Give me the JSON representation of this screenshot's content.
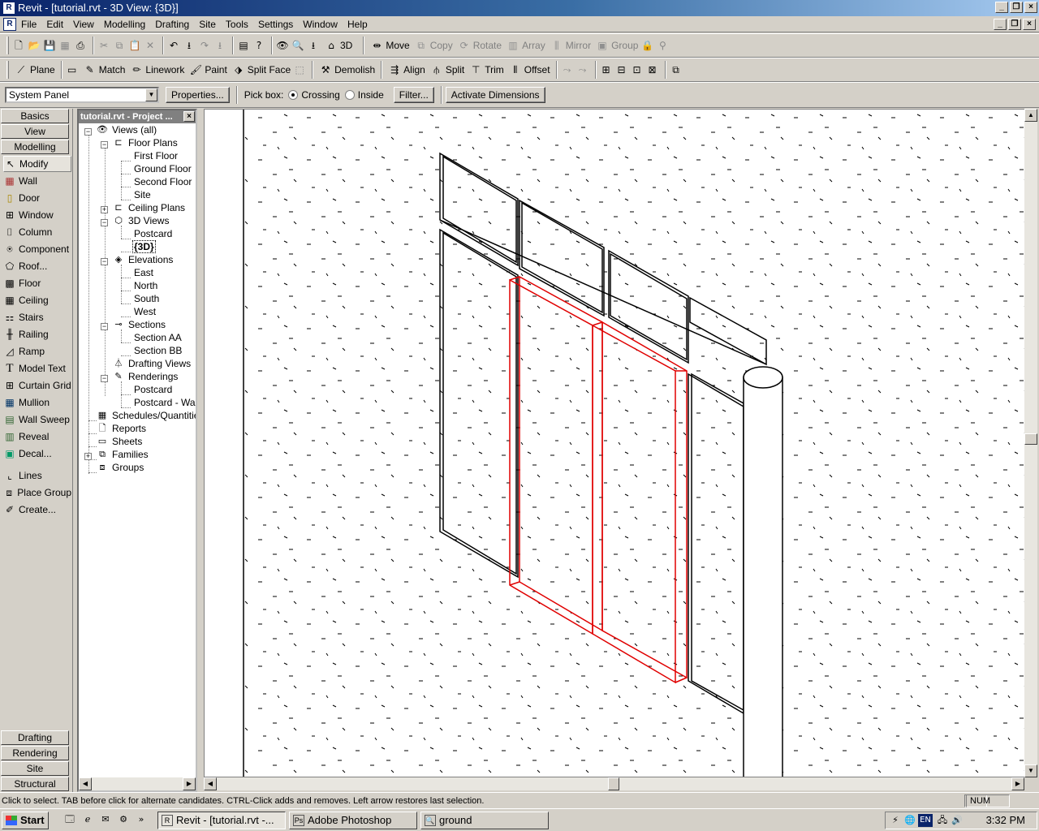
{
  "window": {
    "title": "Revit - [tutorial.rvt - 3D View: {3D}]"
  },
  "menu": [
    "File",
    "Edit",
    "View",
    "Modelling",
    "Drafting",
    "Site",
    "Tools",
    "Settings",
    "Window",
    "Help"
  ],
  "toolbar1": {
    "three_d": "3D",
    "move": "Move",
    "copy": "Copy",
    "rotate": "Rotate",
    "array": "Array",
    "mirror": "Mirror",
    "group": "Group"
  },
  "toolbar2": {
    "plane": "Plane",
    "match": "Match",
    "linework": "Linework",
    "paint": "Paint",
    "split_face": "Split Face",
    "demolish": "Demolish",
    "align": "Align",
    "split": "Split",
    "trim": "Trim",
    "offset": "Offset"
  },
  "options_bar": {
    "type_selector": "System Panel",
    "properties": "Properties...",
    "pick_box_label": "Pick box:",
    "crossing": "Crossing",
    "inside": "Inside",
    "filter": "Filter...",
    "activate_dimensions": "Activate Dimensions"
  },
  "design_bar": {
    "tabs_top": [
      "Basics",
      "View",
      "Modelling"
    ],
    "tools": [
      "Modify",
      "Wall",
      "Door",
      "Window",
      "Column",
      "Component",
      "Roof...",
      "Floor",
      "Ceiling",
      "Stairs",
      "Railing",
      "Ramp",
      "Model Text",
      "Curtain Grid",
      "Mullion",
      "Wall Sweep",
      "Reveal",
      "Decal...",
      "Lines",
      "Place Group",
      "Create..."
    ],
    "tabs_bottom": [
      "Drafting",
      "Rendering",
      "Site",
      "Structural"
    ]
  },
  "project_browser": {
    "title": "tutorial.rvt - Project ...",
    "nodes": [
      "Views (all)",
      "Floor Plans",
      "First Floor",
      "Ground Floor",
      "Second Floor",
      "Site",
      "Ceiling Plans",
      "3D Views",
      "Postcard",
      "{3D}",
      "Elevations",
      "East",
      "North",
      "South",
      "West",
      "Sections",
      "Section AA",
      "Section BB",
      "Drafting Views",
      "Renderings",
      "Postcard",
      "Postcard - Wall",
      "Schedules/Quantities",
      "Reports",
      "Sheets",
      "Families",
      "Groups"
    ]
  },
  "status_bar": {
    "message": "Click to select. TAB before click for alternate candidates. CTRL-Click adds and removes. Left arrow restores last selection.",
    "num": "NUM"
  },
  "taskbar": {
    "start": "Start",
    "tasks": [
      "Revit - [tutorial.rvt -...",
      "Adobe Photoshop",
      "ground"
    ],
    "lang": "EN",
    "clock": "3:32 PM"
  },
  "colors": {
    "title_start": "#0a246a",
    "title_end": "#a6caf0",
    "selection": "#e00000",
    "face": "#d4d0c8"
  }
}
